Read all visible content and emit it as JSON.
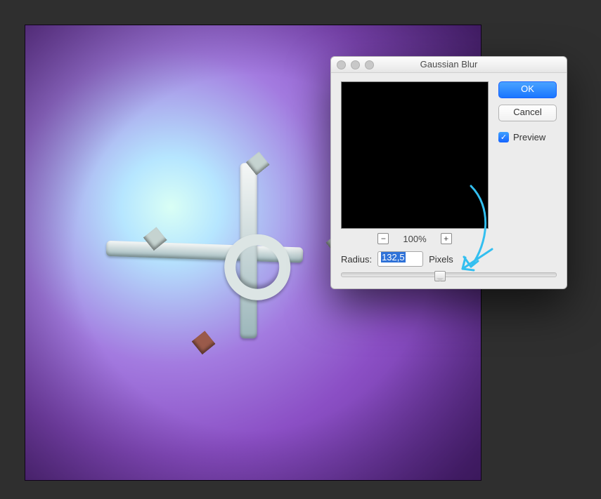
{
  "dialog": {
    "title": "Gaussian Blur",
    "ok_label": "OK",
    "cancel_label": "Cancel",
    "preview_label": "Preview",
    "preview_checked": true,
    "zoom": {
      "minus_label": "−",
      "percent": "100%",
      "plus_label": "+"
    },
    "radius": {
      "label": "Radius:",
      "value": "132,5",
      "unit": "Pixels",
      "slider_percent": 46
    }
  },
  "annotation": {
    "color": "#33bff0"
  }
}
